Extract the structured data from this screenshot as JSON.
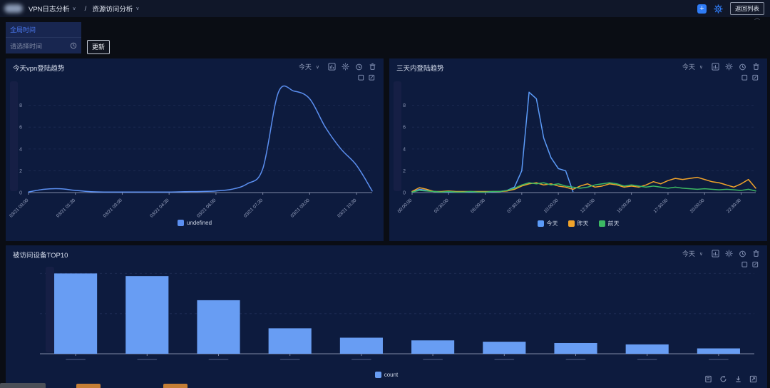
{
  "topbar": {
    "breadcrumb": {
      "item1": "VPN日志分析",
      "separator": "/",
      "item2": "资源访问分析",
      "caret": "∨"
    },
    "add_button": "+",
    "back_button": "返回列表"
  },
  "filters": {
    "global_time": "全局时间",
    "time_placeholder": "请选择时间",
    "update": "更新"
  },
  "panels": [
    {
      "title": "今天vpn登陆趋势",
      "range": "今天",
      "caret": "∨"
    },
    {
      "title": "三天内登陆趋势",
      "range": "今天",
      "caret": "∨"
    },
    {
      "title": "被访问设备TOP10",
      "range": "今天",
      "caret": "∨"
    }
  ],
  "colors": {
    "accent_blue": "#2f7cf6",
    "line_blue": "#5b8ff0",
    "orange": "#f0a32a",
    "green": "#3cb963",
    "bar_blue": "#689df3",
    "panel_bg": "#0d1b3e"
  },
  "chart_data": [
    {
      "id": "chart1",
      "type": "line",
      "smooth": true,
      "title": "今天vpn登陆趋势",
      "x": [
        "03/21 00:00",
        "03/21 00:30",
        "03/21 01:00",
        "03/21 01:30",
        "03/21 02:00",
        "03/21 02:30",
        "03/21 03:00",
        "03/21 03:30",
        "03/21 04:00",
        "03/21 04:30",
        "03/21 05:00",
        "03/21 05:30",
        "03/21 06:00",
        "03/21 06:30",
        "03/21 07:00",
        "03/21 07:30",
        "03/21 08:00",
        "03/21 08:30",
        "03/21 09:00",
        "03/21 09:30",
        "03/21 10:00",
        "03/21 10:30",
        "03/21 11:00"
      ],
      "label_every": 3,
      "ylim": [
        0,
        10.2
      ],
      "yticks": [
        0,
        2,
        4,
        6,
        8
      ],
      "left_slider": true,
      "legend_position": "bottom",
      "series": [
        {
          "name": "undefined",
          "color": "#5b8ff0",
          "values": [
            0.05,
            0.3,
            0.35,
            0.2,
            0.08,
            0.05,
            0.05,
            0.05,
            0.05,
            0.05,
            0.08,
            0.1,
            0.15,
            0.3,
            0.8,
            2.2,
            9.2,
            9.3,
            8.6,
            6.0,
            4.0,
            2.5,
            0.15
          ]
        }
      ]
    },
    {
      "id": "chart2",
      "type": "line",
      "smooth": false,
      "title": "三天内登陆趋势",
      "x": [
        "00:00:00",
        "00:30:00",
        "01:00:00",
        "01:30:00",
        "02:00:00",
        "02:30:00",
        "03:00:00",
        "03:30:00",
        "04:00:00",
        "04:30:00",
        "05:00:00",
        "05:30:00",
        "06:00:00",
        "06:30:00",
        "07:00:00",
        "07:30:00",
        "08:00:00",
        "08:30:00",
        "09:00:00",
        "09:30:00",
        "10:00:00",
        "10:30:00",
        "11:00:00",
        "11:30:00",
        "12:00:00",
        "12:30:00",
        "13:00:00",
        "13:30:00",
        "14:00:00",
        "14:30:00",
        "15:00:00",
        "15:30:00",
        "16:00:00",
        "16:30:00",
        "17:00:00",
        "17:30:00",
        "18:00:00",
        "18:30:00",
        "19:00:00",
        "19:30:00",
        "20:00:00",
        "20:30:00",
        "21:00:00",
        "21:30:00",
        "22:00:00",
        "22:30:00",
        "23:00:00",
        "23:30:00"
      ],
      "label_every": 5,
      "ylim": [
        0,
        10.2
      ],
      "yticks": [
        0,
        2,
        4,
        6,
        8
      ],
      "left_slider": true,
      "legend_position": "bottom",
      "series": [
        {
          "name": "今天",
          "color": "#5b9bf8",
          "values": [
            0.05,
            0.3,
            0.2,
            0.1,
            0.05,
            0.05,
            0.05,
            0.05,
            0.05,
            0.05,
            0.05,
            0.05,
            0.1,
            0.2,
            0.5,
            2.0,
            9.2,
            8.6,
            5.0,
            3.2,
            2.2,
            2.0,
            0.1,
            null,
            null,
            null,
            null,
            null,
            null,
            null,
            null,
            null,
            null,
            null,
            null,
            null,
            null,
            null,
            null,
            null,
            null,
            null,
            null,
            null,
            null,
            null,
            null,
            null
          ]
        },
        {
          "name": "昨天",
          "color": "#f0a32a",
          "values": [
            0.1,
            0.45,
            0.3,
            0.1,
            0.1,
            0.15,
            0.1,
            0.1,
            0.1,
            0.1,
            0.1,
            0.1,
            0.1,
            0.15,
            0.3,
            0.6,
            0.8,
            0.9,
            0.7,
            0.8,
            0.6,
            0.5,
            0.3,
            0.6,
            0.8,
            0.5,
            0.6,
            0.8,
            0.7,
            0.5,
            0.6,
            0.5,
            0.7,
            1.0,
            0.8,
            1.1,
            1.3,
            1.2,
            1.3,
            1.4,
            1.2,
            1.0,
            0.9,
            0.7,
            0.5,
            0.8,
            1.2,
            0.4
          ]
        },
        {
          "name": "前天",
          "color": "#3cb963",
          "values": [
            0.05,
            0.2,
            0.15,
            0.1,
            0.05,
            0.1,
            0.05,
            0.05,
            0.1,
            0.05,
            0.05,
            0.1,
            0.1,
            0.2,
            0.4,
            0.7,
            0.9,
            0.8,
            0.9,
            0.7,
            0.8,
            0.6,
            0.5,
            0.4,
            0.5,
            0.7,
            0.8,
            0.9,
            0.8,
            0.6,
            0.7,
            0.6,
            0.5,
            0.6,
            0.5,
            0.4,
            0.5,
            0.4,
            0.35,
            0.3,
            0.35,
            0.3,
            0.25,
            0.3,
            0.25,
            0.2,
            0.3,
            0.15
          ]
        }
      ]
    },
    {
      "id": "chart3",
      "type": "bar",
      "title": "被访问设备TOP10",
      "categories": [
        "",
        "",
        "",
        "",
        "",
        "",
        "",
        "",
        "",
        ""
      ],
      "labels_illegible": true,
      "values": [
        60,
        58,
        40,
        19,
        12,
        10,
        9,
        8,
        7,
        4
      ],
      "ylim": [
        0,
        65
      ],
      "yticks": [
        30,
        60
      ],
      "hide_ytick_labels": true,
      "left_slider": true,
      "legend_position": "bottom",
      "series": [
        {
          "name": "count",
          "color": "#689df3",
          "values": [
            60,
            58,
            40,
            19,
            12,
            10,
            9,
            8,
            7,
            4
          ]
        }
      ]
    }
  ]
}
